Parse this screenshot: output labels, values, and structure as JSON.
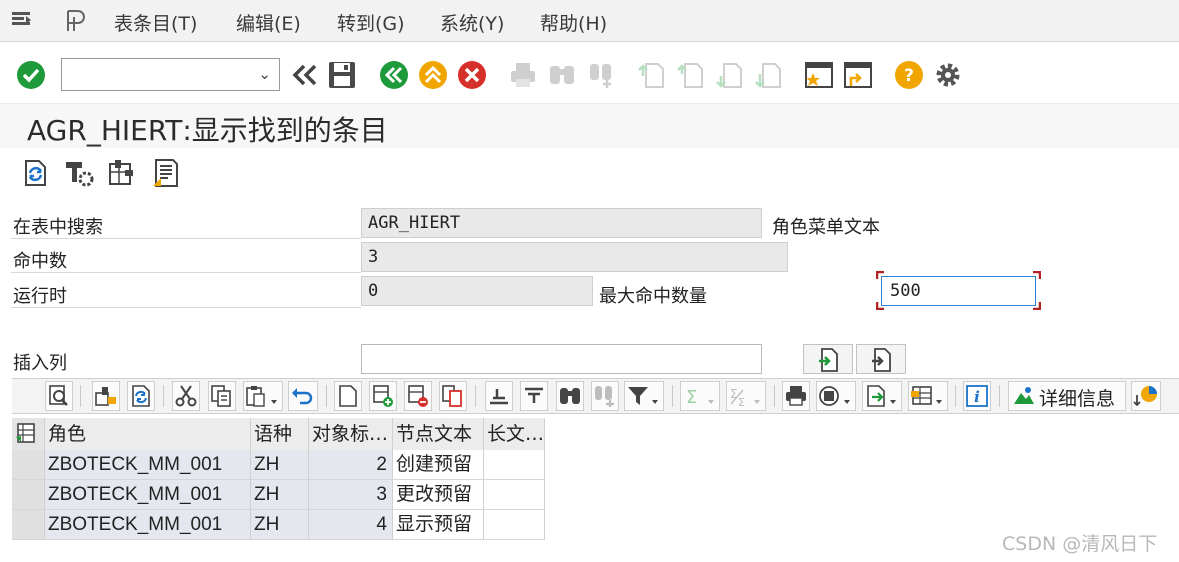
{
  "menu": {
    "items": [
      "表条目(T)",
      "编辑(E)",
      "转到(G)",
      "系统(Y)",
      "帮助(H)"
    ]
  },
  "toolbar": {
    "command_field_value": "",
    "icons": [
      "enter-icon",
      "save-icon",
      "back-icon",
      "exit-icon",
      "cancel-icon",
      "print-icon",
      "find-icon",
      "find-next-icon",
      "first-page-icon",
      "previous-page-icon",
      "next-page-icon",
      "last-page-icon",
      "create-session-icon",
      "shortcut-icon",
      "help-icon",
      "settings-icon"
    ],
    "colors": {
      "enter": "#1f9a3a",
      "back": "#1f9a3a",
      "exit": "#f0a500",
      "cancel": "#d6302a",
      "help": "#f0a500"
    }
  },
  "title": {
    "table": "AGR_HIERT",
    "sep": ":",
    "text": "显示找到的条目"
  },
  "app_toolbar": {
    "icons": [
      "refresh-icon",
      "settings-tool-icon",
      "check-table-icon",
      "number-of-entries-icon"
    ]
  },
  "form": {
    "search_table_label": "在表中搜索",
    "search_table_value": "AGR_HIERT",
    "search_table_desc": "角色菜单文本",
    "hits_label": "命中数",
    "hits_value": "3",
    "runtime_label": "运行时",
    "runtime_value": "0",
    "max_hits_label": "最大命中数量",
    "max_hits_value": "500",
    "insert_column_label": "插入列",
    "insert_column_value": ""
  },
  "alv": {
    "details_label": "详细信息",
    "columns": [
      "角色",
      "语种",
      "对象标…",
      "节点文本",
      "长文…"
    ],
    "rows": [
      {
        "role": "ZBOTECK_MM_001",
        "lang": "ZH",
        "obj": "2",
        "text": "创建预留",
        "long": ""
      },
      {
        "role": "ZBOTECK_MM_001",
        "lang": "ZH",
        "obj": "3",
        "text": "更改预留",
        "long": ""
      },
      {
        "role": "ZBOTECK_MM_001",
        "lang": "ZH",
        "obj": "4",
        "text": "显示预留",
        "long": ""
      }
    ]
  },
  "watermark": "CSDN @清风日下"
}
